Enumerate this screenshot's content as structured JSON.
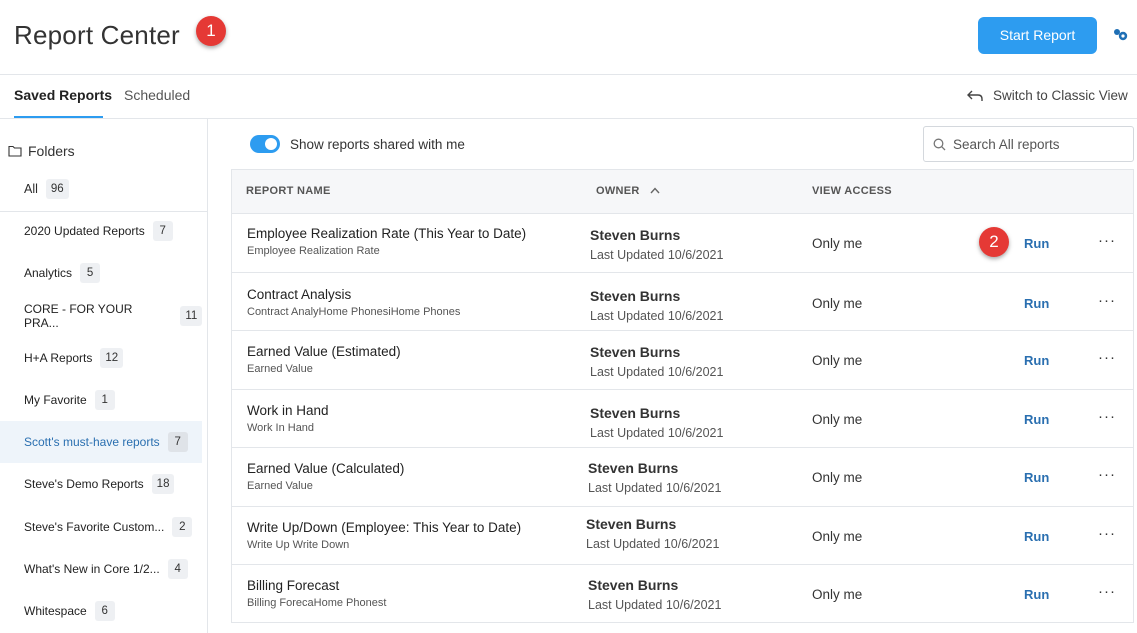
{
  "header": {
    "title": "Report Center",
    "start_button": "Start Report",
    "callout_1": "1",
    "callout_2": "2"
  },
  "tabs": {
    "saved": "Saved Reports",
    "scheduled": "Scheduled",
    "switch_view": "Switch to Classic View"
  },
  "sidebar": {
    "folders_label": "Folders",
    "all_label": "All",
    "all_count": "96",
    "items": [
      {
        "label": "2020 Updated Reports",
        "count": "7"
      },
      {
        "label": "Analytics",
        "count": "5"
      },
      {
        "label": "CORE - FOR YOUR PRA...",
        "count": "11"
      },
      {
        "label": "H+A Reports",
        "count": "12"
      },
      {
        "label": "My Favorite",
        "count": "1"
      },
      {
        "label": "Scott's must-have reports",
        "count": "7"
      },
      {
        "label": "Steve's Demo Reports",
        "count": "18"
      },
      {
        "label": "Steve's Favorite Custom...",
        "count": "2"
      },
      {
        "label": "What's New in Core 1/2...",
        "count": "4"
      },
      {
        "label": "Whitespace",
        "count": "6"
      }
    ]
  },
  "toolbar": {
    "toggle_label": "Show reports shared with me",
    "search_placeholder": "Search All reports"
  },
  "table": {
    "headers": {
      "name": "REPORT NAME",
      "owner": "OWNER",
      "access": "VIEW ACCESS"
    },
    "rows": [
      {
        "name": "Employee Realization Rate (This Year to Date)",
        "sub": "Employee Realization Rate",
        "owner": "Steven Burns",
        "updated": "Last Updated 10/6/2021",
        "access": "Only me",
        "run": "Run",
        "more": "···"
      },
      {
        "name": "Contract Analysis",
        "sub": "Contract AnalyHome PhonesiHome Phones",
        "owner": "Steven Burns",
        "updated": "Last Updated 10/6/2021",
        "access": "Only me",
        "run": "Run",
        "more": "···"
      },
      {
        "name": "Earned Value (Estimated)",
        "sub": "Earned Value",
        "owner": "Steven Burns",
        "updated": "Last Updated 10/6/2021",
        "access": "Only me",
        "run": "Run",
        "more": "···"
      },
      {
        "name": "Work in Hand",
        "sub": "Work In Hand",
        "owner": "Steven Burns",
        "updated": "Last Updated 10/6/2021",
        "access": "Only me",
        "run": "Run",
        "more": "···"
      },
      {
        "name": "Earned Value (Calculated)",
        "sub": "Earned Value",
        "owner": "Steven Burns",
        "updated": "Last Updated 10/6/2021",
        "access": "Only me",
        "run": "Run",
        "more": "···"
      },
      {
        "name": "Write Up/Down (Employee: This Year to Date)",
        "sub": "Write Up Write Down",
        "owner": "Steven Burns",
        "updated": "Last Updated 10/6/2021",
        "access": "Only me",
        "run": "Run",
        "more": "···"
      },
      {
        "name": "Billing Forecast",
        "sub": "Billing ForecaHome Phonest",
        "owner": "Steven Burns",
        "updated": "Last Updated 10/6/2021",
        "access": "Only me",
        "run": "Run",
        "more": "···"
      }
    ]
  },
  "colors": {
    "accent": "#2d9cf0",
    "link": "#2a6fb0",
    "callout": "#e53935"
  }
}
